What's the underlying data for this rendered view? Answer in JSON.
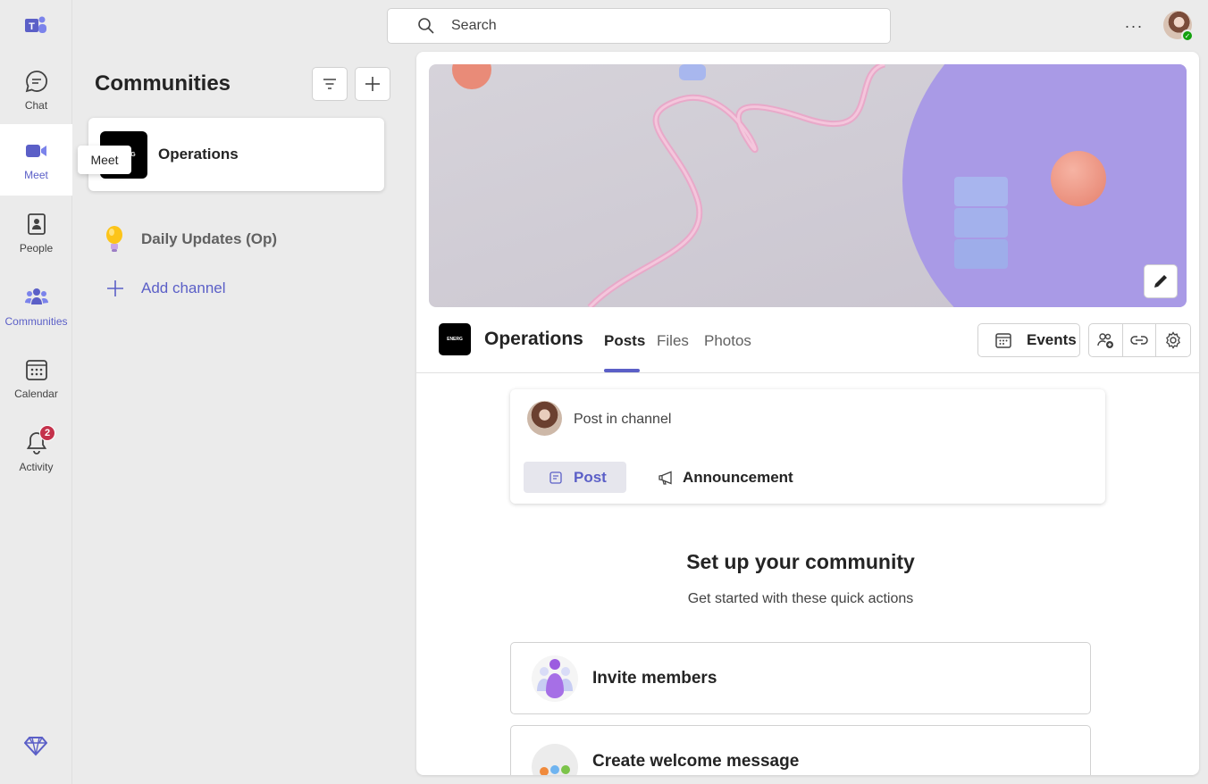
{
  "rail": {
    "items": [
      {
        "label": "Chat",
        "icon": "chat-icon"
      },
      {
        "label": "Meet",
        "icon": "video-camera-icon"
      },
      {
        "label": "People",
        "icon": "contact-book-icon"
      },
      {
        "label": "Communities",
        "icon": "people-community-icon"
      },
      {
        "label": "Calendar",
        "icon": "calendar-icon"
      },
      {
        "label": "Activity",
        "icon": "bell-icon"
      }
    ],
    "active": "Communities",
    "activity_badge": "2",
    "tooltip": "Meet",
    "accent": "#5b5fc7"
  },
  "search": {
    "placeholder": "Search"
  },
  "panel": {
    "title": "Communities",
    "community_name": "Operations",
    "logo_text": "ENERG",
    "channels": [
      {
        "name": "Daily Updates (Op)",
        "icon": "lightbulb-icon"
      }
    ],
    "add_channel": "Add channel"
  },
  "main": {
    "community_name": "Operations",
    "tabs": [
      "Posts",
      "Files",
      "Photos"
    ],
    "active_tab": "Posts",
    "events_label": "Events",
    "composer": {
      "placeholder": "Post in channel",
      "post_label": "Post",
      "announcement_label": "Announcement"
    },
    "setup": {
      "title": "Set up your community",
      "subtitle": "Get started with these quick actions"
    },
    "actions": [
      {
        "label": "Invite members"
      },
      {
        "label": "Create welcome message"
      }
    ]
  }
}
